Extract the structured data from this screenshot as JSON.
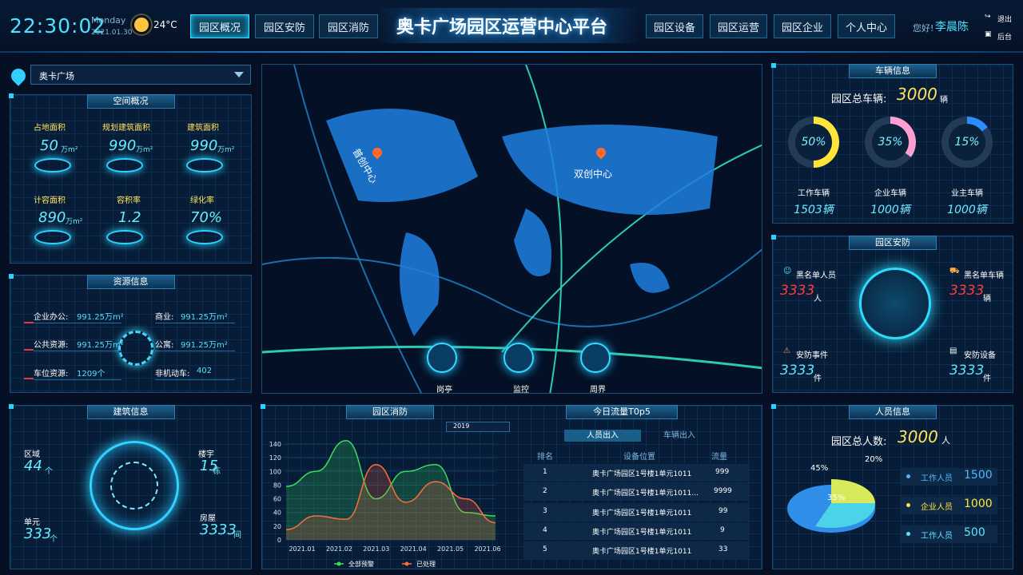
{
  "header": {
    "time": "22:30:02",
    "weekday": "Monday",
    "date": "2021.01.30",
    "temp": "24°C",
    "nav_left": [
      "园区概况",
      "园区安防",
      "园区消防"
    ],
    "title": "奥卡广场园区运营中心平台",
    "nav_right": [
      "园区设备",
      "园区运营",
      "园区企业",
      "个人中心"
    ],
    "greeting": "您好!",
    "user": "李晨陈",
    "exit": "退出",
    "backend": "后台"
  },
  "location": {
    "selected": "奥卡广场"
  },
  "space": {
    "title": "空间概况",
    "items": [
      {
        "label": "占地面积",
        "value": "50",
        "unit": "万m²"
      },
      {
        "label": "规划建筑面积",
        "value": "990",
        "unit": "万m²"
      },
      {
        "label": "建筑面积",
        "value": "990",
        "unit": "万m²"
      },
      {
        "label": "计容面积",
        "value": "890",
        "unit": "万m²"
      },
      {
        "label": "容积率",
        "value": "1.2",
        "unit": ""
      },
      {
        "label": "绿化率",
        "value": "70%",
        "unit": ""
      }
    ]
  },
  "resource": {
    "title": "资源信息",
    "rows": [
      {
        "k": "企业办公:",
        "v": "991.25万m²"
      },
      {
        "k": "商业:",
        "v": "991.25万m²"
      },
      {
        "k": "公共资源:",
        "v": "991.25万m²"
      },
      {
        "k": "公寓:",
        "v": "991.25万m²"
      },
      {
        "k": "车位资源:",
        "v": "1209个"
      },
      {
        "k": "非机动车:",
        "v": "402"
      }
    ]
  },
  "building": {
    "title": "建筑信息",
    "items": [
      {
        "label": "区域",
        "value": "44",
        "unit": "个"
      },
      {
        "label": "楼宇",
        "value": "15",
        "unit": "栋"
      },
      {
        "label": "单元",
        "value": "333",
        "unit": "个"
      },
      {
        "label": "房屋",
        "value": "3333",
        "unit": "间"
      }
    ]
  },
  "map": {
    "labels": [
      "普创中心",
      "双创中心"
    ],
    "buttons": [
      "岗亭",
      "监控",
      "周界"
    ]
  },
  "vehicle": {
    "title": "车辆信息",
    "total_label": "园区总车辆:",
    "total": "3000",
    "total_unit": "辆",
    "rings": [
      {
        "pct": "50%",
        "label": "工作车辆",
        "num": "1503辆",
        "color": "#ffe53b",
        "fill": 0.5
      },
      {
        "pct": "35%",
        "label": "企业车辆",
        "num": "1000辆",
        "color": "#ff9fd1",
        "fill": 0.35
      },
      {
        "pct": "15%",
        "label": "业主车辆",
        "num": "1000辆",
        "color": "#2a8cff",
        "fill": 0.15
      }
    ]
  },
  "security": {
    "title": "园区安防",
    "items": [
      {
        "label": "黑名单人员",
        "value": "3333",
        "unit": "人",
        "color": "#ff3b3b"
      },
      {
        "label": "黑名单车辆",
        "value": "3333",
        "unit": "辆",
        "color": "#ff3b3b"
      },
      {
        "label": "安防事件",
        "value": "3333",
        "unit": "件",
        "color": "#5fe4ff"
      },
      {
        "label": "安防设备",
        "value": "3333",
        "unit": "件",
        "color": "#5fe4ff"
      }
    ]
  },
  "fire": {
    "title": "园区消防",
    "year": "2019"
  },
  "flow": {
    "title": "今日流量T0p5",
    "tabs": [
      "人员出入",
      "车辆出入"
    ],
    "headers": [
      "排名",
      "设备位置",
      "流量"
    ],
    "rows": [
      {
        "rank": "1",
        "loc": "奥卡广场园区1号楼1单元1011",
        "val": "999"
      },
      {
        "rank": "2",
        "loc": "奥卡广场园区1号楼1单元1011...",
        "val": "9999"
      },
      {
        "rank": "3",
        "loc": "奥卡广场园区1号楼1单元1011",
        "val": "99"
      },
      {
        "rank": "4",
        "loc": "奥卡广场园区1号楼1单元1011",
        "val": "9"
      },
      {
        "rank": "5",
        "loc": "奥卡广场园区1号楼1单元1011",
        "val": "33"
      }
    ]
  },
  "people": {
    "title": "人员信息",
    "total_label": "园区总人数:",
    "total": "3000",
    "unit": "人",
    "pcts": [
      "45%",
      "35%",
      "20%"
    ],
    "legend": [
      {
        "label": "工作人员",
        "value": "1500",
        "color": "#4fb8ff"
      },
      {
        "label": "企业人员",
        "value": "1000",
        "color": "#ffe53b"
      },
      {
        "label": "工作人员",
        "value": "500",
        "color": "#5ee6ff"
      }
    ]
  },
  "chart_data": {
    "type": "area",
    "x": [
      "2021.01",
      "2021.02",
      "2021.03",
      "2021.04",
      "2021.05",
      "2021.06"
    ],
    "ylim": [
      0,
      140
    ],
    "yticks": [
      0,
      20,
      40,
      60,
      80,
      100,
      120,
      140
    ],
    "series": [
      {
        "name": "全部预警",
        "color": "#3ddc5a",
        "values": [
          78,
          100,
          145,
          60,
          100,
          110,
          40,
          35
        ]
      },
      {
        "name": "已处理",
        "color": "#ff6b3b",
        "values": [
          15,
          35,
          30,
          110,
          55,
          85,
          60,
          25
        ]
      }
    ]
  }
}
